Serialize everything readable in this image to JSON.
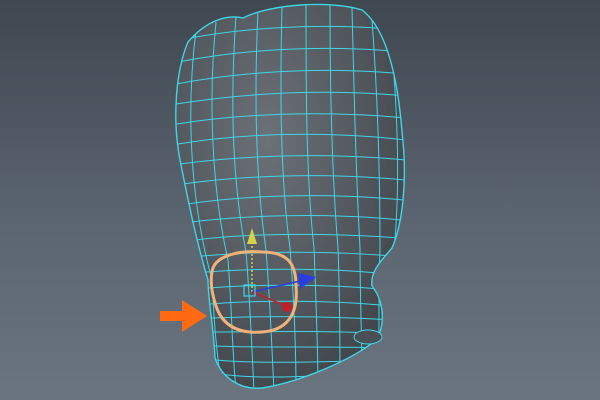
{
  "viewport": {
    "background_top": "#3f4750",
    "background_bottom": "#6a7580"
  },
  "mesh": {
    "surface_color": "#555a60",
    "wireframe_color": "#3fd6e8",
    "selection_color": "#f0b27a"
  },
  "manipulator": {
    "y_axis_color": "#d8d24a",
    "x_axis_color": "#c4202a",
    "z_axis_color": "#2a3de0",
    "center_color": "#3fd6e8"
  },
  "annotation": {
    "arrow_icon": "arrow-right-icon",
    "arrow_color": "#ff6a13"
  }
}
